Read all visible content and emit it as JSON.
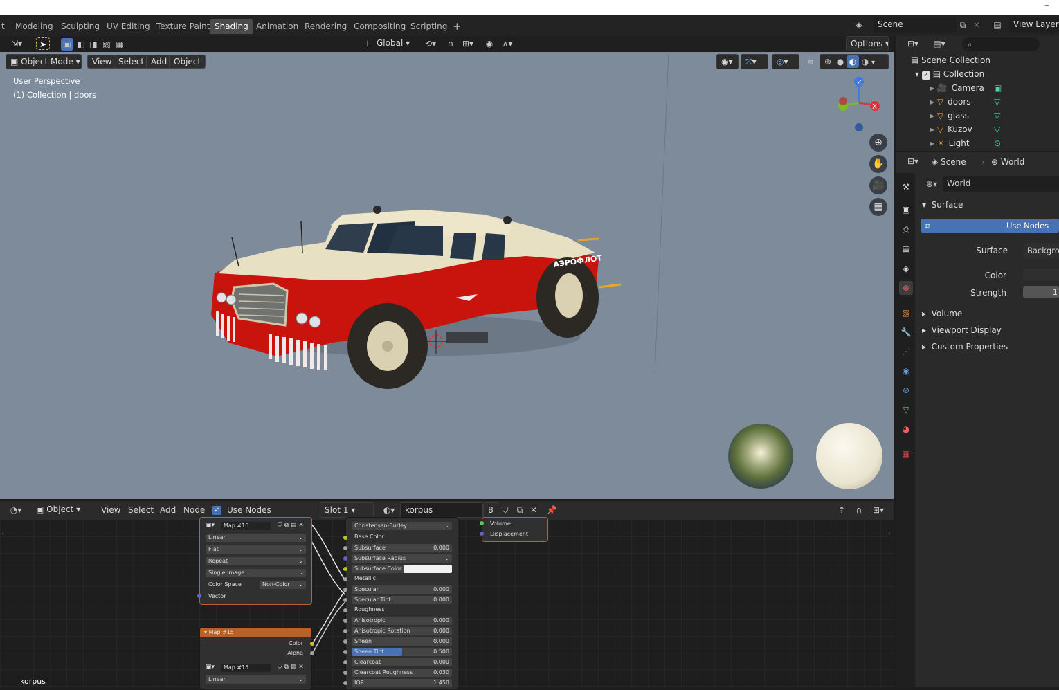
{
  "window": {
    "minimize": "–"
  },
  "workspace_tabs": [
    "Modeling",
    "Sculpting",
    "UV Editing",
    "Texture Paint",
    "Shading",
    "Animation",
    "Rendering",
    "Compositing",
    "Scripting",
    "+"
  ],
  "active_tab": "Shading",
  "scene_selector": {
    "value": "Scene"
  },
  "view_layer_selector": {
    "value": "View Layer"
  },
  "viewport": {
    "transform_orientation": "Global",
    "options_label": "Options",
    "mode": "Object Mode",
    "menu": [
      "View",
      "Select",
      "Add",
      "Object"
    ],
    "info_line1": "User Perspective",
    "info_line2": "(1) Collection | doors",
    "gizmo": {
      "z": "Z",
      "x": "X"
    },
    "car_text": "АЭРОФЛОТ"
  },
  "outliner": {
    "root": "Scene Collection",
    "collection": "Collection",
    "items": [
      {
        "name": "Camera",
        "icon": "camera-icon"
      },
      {
        "name": "doors",
        "icon": "mesh-icon"
      },
      {
        "name": "glass",
        "icon": "mesh-icon"
      },
      {
        "name": "Kuzov",
        "icon": "mesh-icon"
      },
      {
        "name": "Light",
        "icon": "light-icon"
      }
    ]
  },
  "properties": {
    "breadcrumb_scene": "Scene",
    "breadcrumb_world": "World",
    "world_name": "World",
    "panel_surface": "Surface",
    "use_nodes": "Use Nodes",
    "surface_label": "Surface",
    "surface_value": "Backgrou",
    "color_label": "Color",
    "strength_label": "Strength",
    "strength_value": "1",
    "collapsed_panels": [
      "Volume",
      "Viewport Display",
      "Custom Properties"
    ]
  },
  "node_editor": {
    "type": "Object",
    "menu": [
      "View",
      "Select",
      "Add",
      "Node"
    ],
    "use_nodes": "Use Nodes",
    "slot": "Slot 1",
    "material": "korpus",
    "users": "8",
    "footer_label": "korpus",
    "map16": {
      "image": "Map #16",
      "interpolation": "Linear",
      "projection": "Flat",
      "extension": "Repeat",
      "source": "Single Image",
      "colorspace_label": "Color Space",
      "colorspace_value": "Non-Color",
      "vector": "Vector"
    },
    "map15": {
      "title": "Map #15",
      "color": "Color",
      "alpha": "Alpha",
      "image": "Map #15",
      "interpolation": "Linear"
    },
    "bsdf": {
      "subsurface_method": "Christensen-Burley",
      "rows": [
        {
          "label": "Base Color",
          "value": ""
        },
        {
          "label": "Subsurface",
          "value": "0.000"
        },
        {
          "label": "Subsurface Radius",
          "value": ""
        },
        {
          "label": "Subsurface Color",
          "value": ""
        },
        {
          "label": "Metallic",
          "value": ""
        },
        {
          "label": "Specular",
          "value": "0.000"
        },
        {
          "label": "Specular Tint",
          "value": "0.000"
        },
        {
          "label": "Roughness",
          "value": ""
        },
        {
          "label": "Anisotropic",
          "value": "0.000"
        },
        {
          "label": "Anisotropic Rotation",
          "value": "0.000"
        },
        {
          "label": "Sheen",
          "value": "0.000"
        },
        {
          "label": "Sheen Tint",
          "value": "0.500"
        },
        {
          "label": "Clearcoat",
          "value": "0.000"
        },
        {
          "label": "Clearcoat Roughness",
          "value": "0.030"
        },
        {
          "label": "IOR",
          "value": "1.450"
        }
      ],
      "sheen_tint_fill": 0.5
    },
    "output": {
      "volume": "Volume",
      "displacement": "Displacement"
    }
  },
  "colors": {
    "accent": "#4772b3",
    "node_header_orange": "#b8612b",
    "car_red": "#c9140e",
    "car_cream": "#e7e0c3"
  }
}
